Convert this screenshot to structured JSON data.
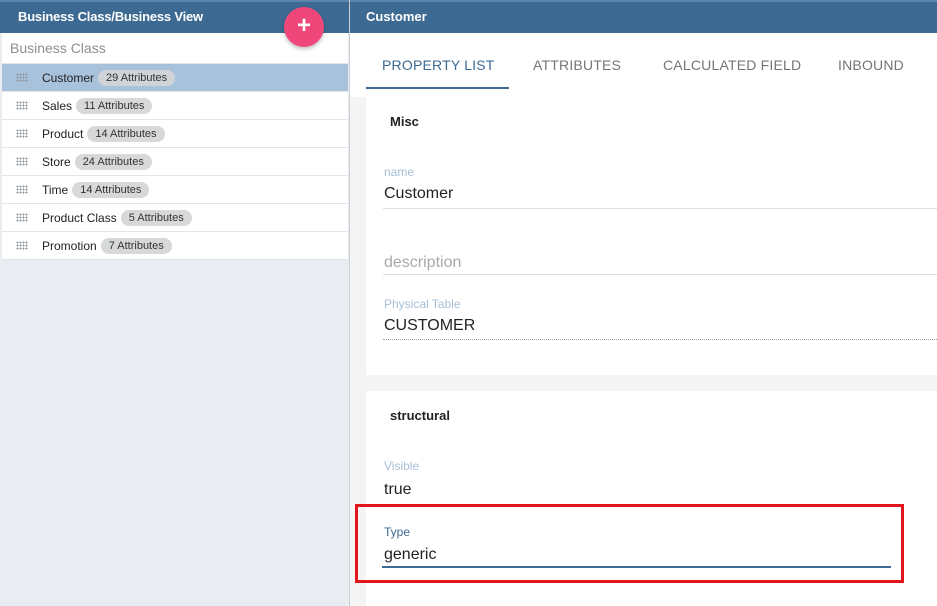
{
  "left_panel": {
    "title": "Business Class/Business View",
    "add_button_icon": "plus-icon",
    "add_button_label": "+",
    "list_heading": "Business Class",
    "items": [
      {
        "label": "Customer",
        "badge": "29 Attributes",
        "selected": true
      },
      {
        "label": "Sales",
        "badge": "11 Attributes"
      },
      {
        "label": "Product",
        "badge": "14 Attributes"
      },
      {
        "label": "Store",
        "badge": "24 Attributes"
      },
      {
        "label": "Time",
        "badge": "14 Attributes"
      },
      {
        "label": "Product Class",
        "badge": "5 Attributes"
      },
      {
        "label": "Promotion",
        "badge": "7 Attributes"
      }
    ]
  },
  "right_panel": {
    "title": "Customer",
    "tabs": [
      {
        "label": "PROPERTY LIST",
        "active": true
      },
      {
        "label": "ATTRIBUTES"
      },
      {
        "label": "CALCULATED FIELD"
      },
      {
        "label": "INBOUND"
      }
    ],
    "misc": {
      "title": "Misc",
      "name_label": "name",
      "name_value": "Customer",
      "description_placeholder": "description",
      "physical_table_label": "Physical Table",
      "physical_table_value": "CUSTOMER"
    },
    "structural": {
      "title": "structural",
      "visible_label": "Visible",
      "visible_value": "true",
      "type_label": "Type",
      "type_value": "generic"
    }
  },
  "colors": {
    "header": "#3d6a93",
    "fab": "#f0477b",
    "selected_row": "#a9c2dc",
    "highlight_box": "#e3151c"
  }
}
